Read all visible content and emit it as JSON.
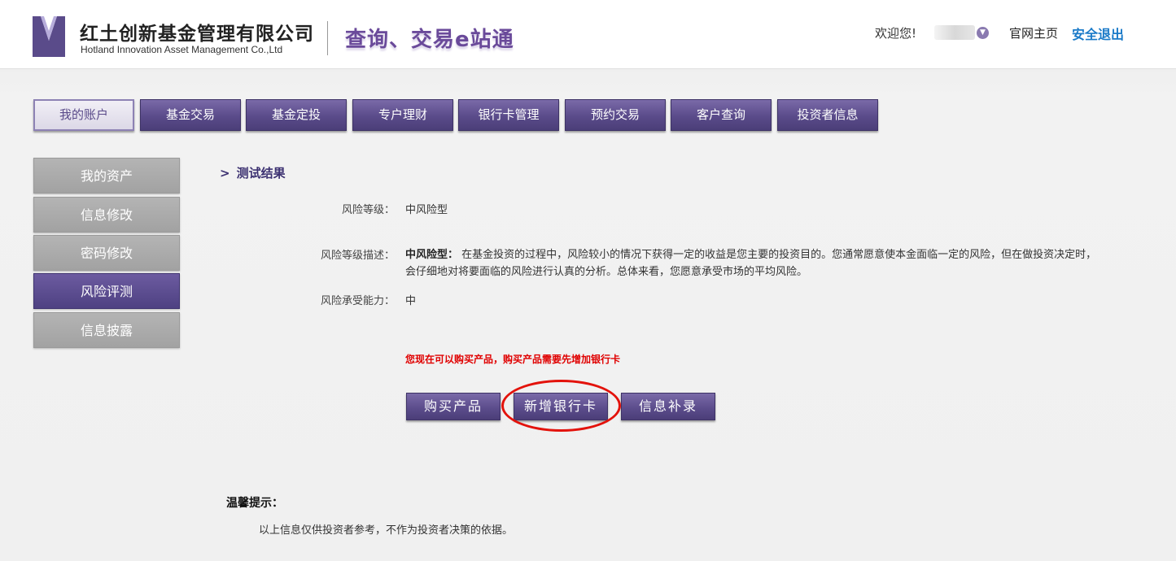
{
  "header": {
    "company_cn": "红土创新基金管理有限公司",
    "company_en": "Hotland Innovation Asset Management Co.,Ltd",
    "slogan": "查询、交易e站通",
    "welcome": "欢迎您!",
    "home_link": "官网主页",
    "logout_link": "安全退出",
    "brand_color": "#5a4b8a",
    "link_color": "#1a7ac8"
  },
  "nav": {
    "items": [
      {
        "label": "我的账户"
      },
      {
        "label": "基金交易"
      },
      {
        "label": "基金定投"
      },
      {
        "label": "专户理财"
      },
      {
        "label": "银行卡管理"
      },
      {
        "label": "预约交易"
      },
      {
        "label": "客户查询"
      },
      {
        "label": "投资者信息"
      }
    ],
    "active_index": 0
  },
  "sidebar": {
    "items": [
      {
        "label": "我的资产"
      },
      {
        "label": "信息修改"
      },
      {
        "label": "密码修改"
      },
      {
        "label": "风险评测"
      },
      {
        "label": "信息披露"
      }
    ],
    "active_index": 3
  },
  "content": {
    "section_arrow": ">",
    "section_title": "测试结果",
    "risk_level_label": "风险等级：",
    "risk_level_value": "中风险型",
    "risk_desc_label": "风险等级描述：",
    "risk_desc_type": "中风险型：",
    "risk_desc_text": "在基金投资的过程中，风险较小的情况下获得一定的收益是您主要的投资目的。您通常愿意使本金面临一定的风险，但在做投资决定时，会仔细地对将要面临的风险进行认真的分析。总体来看，您愿意承受市场的平均风险。",
    "risk_capacity_label": "风险承受能力：",
    "risk_capacity_value": "中",
    "notice": "您现在可以购买产品，购买产品需要先增加银行卡",
    "notice_color": "#e00000",
    "buttons": {
      "buy": "购买产品",
      "add_card": "新增银行卡",
      "supplement": "信息补录"
    }
  },
  "tips": {
    "title": "温馨提示：",
    "text": "以上信息仅供投资者参考，不作为投资者决策的依据。"
  }
}
